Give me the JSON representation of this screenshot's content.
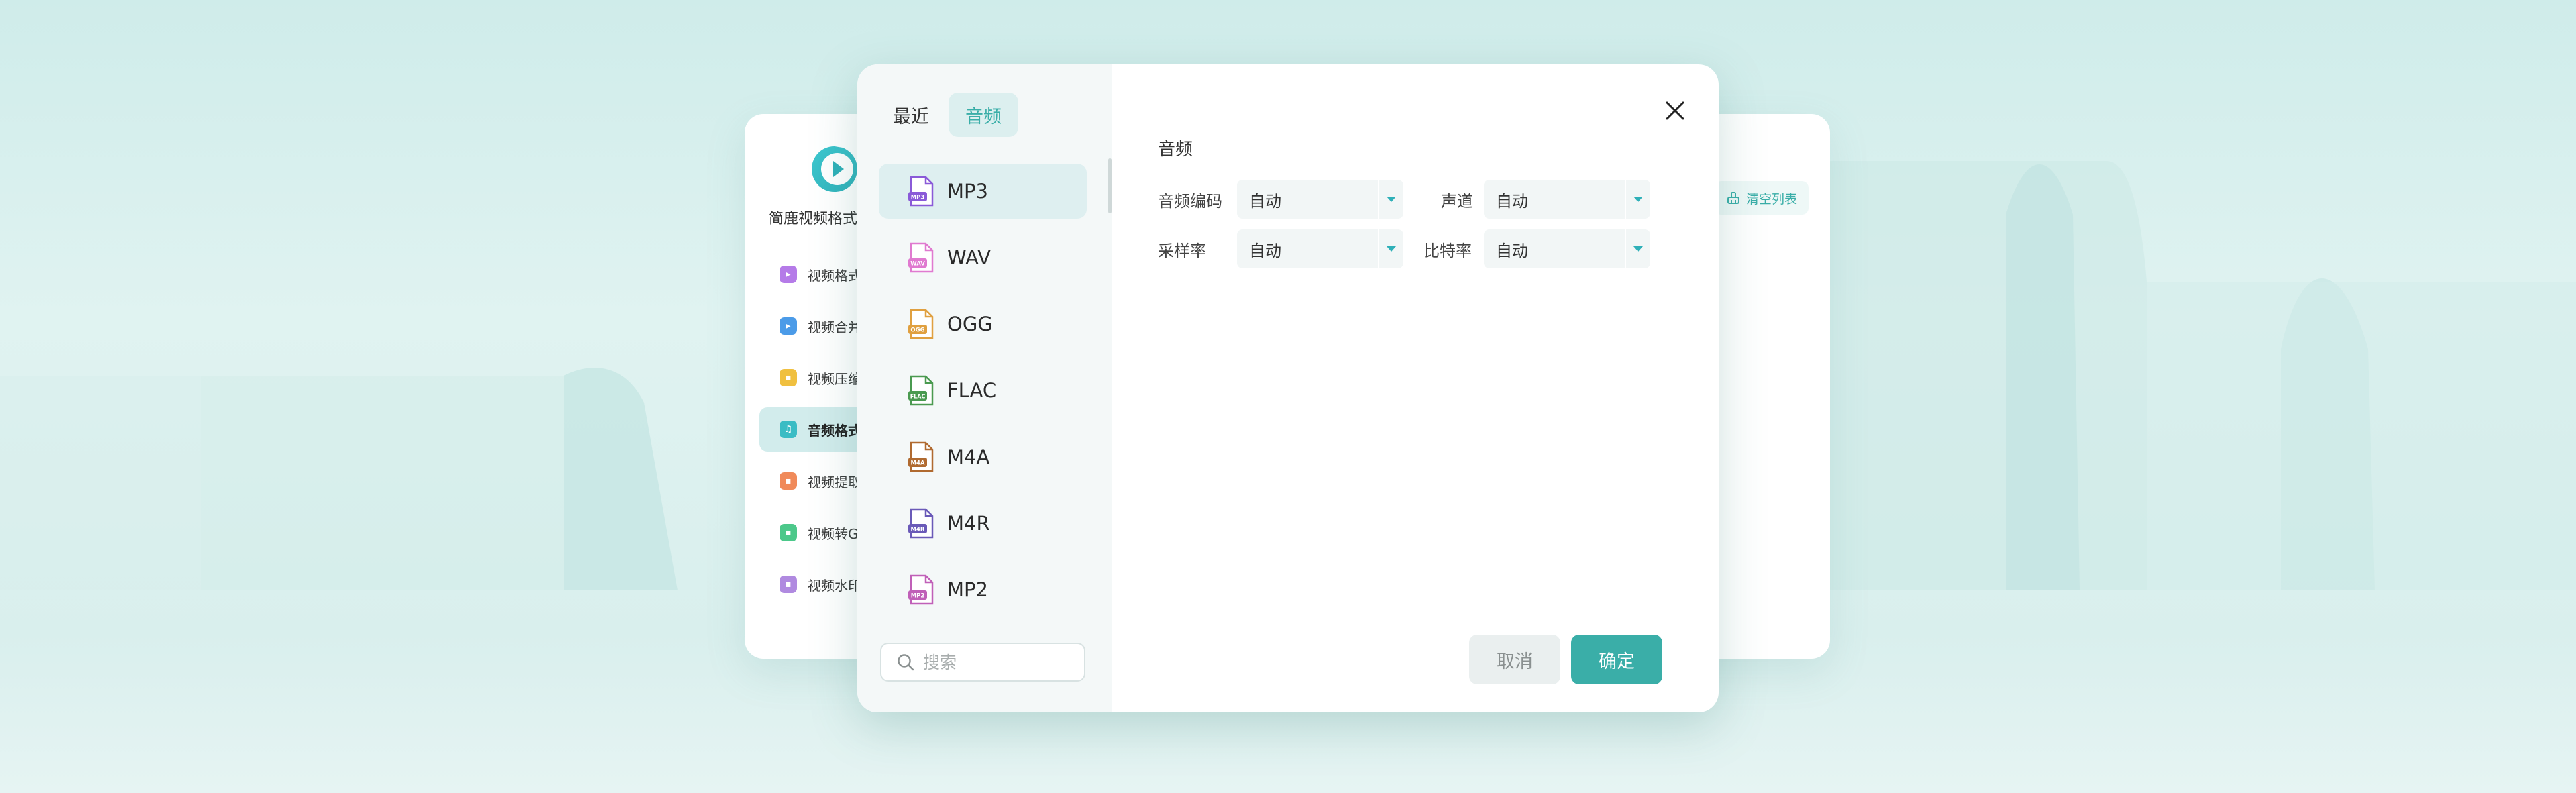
{
  "app": {
    "name": "简鹿视频格式",
    "clear_list_label": "清空列表",
    "nav": [
      {
        "label": "视频格式",
        "icon": "video-convert-icon",
        "color": "#b57be8"
      },
      {
        "label": "视频合并",
        "icon": "video-merge-icon",
        "color": "#4b9be8"
      },
      {
        "label": "视频压缩",
        "icon": "video-compress-icon",
        "color": "#f0c040"
      },
      {
        "label": "音频格式",
        "icon": "audio-convert-icon",
        "color": "#3abcc4"
      },
      {
        "label": "视频提取",
        "icon": "video-extract-icon",
        "color": "#f08a5a"
      },
      {
        "label": "视频转GIF",
        "icon": "video-gif-icon",
        "color": "#4cc88a"
      },
      {
        "label": "视频水印",
        "icon": "video-watermark-icon",
        "color": "#b08ae0"
      }
    ]
  },
  "dialog": {
    "tabs": {
      "recent": "最近",
      "audio": "音频"
    },
    "formats": [
      {
        "label": "MP3",
        "badge": "MP3",
        "color": "#8a5ad8"
      },
      {
        "label": "WAV",
        "badge": "WAV",
        "color": "#e07ad0"
      },
      {
        "label": "OGG",
        "badge": "OGG",
        "color": "#e0a040"
      },
      {
        "label": "FLAC",
        "badge": "FLAC",
        "color": "#4a9a50"
      },
      {
        "label": "M4A",
        "badge": "M4A",
        "color": "#b06a30"
      },
      {
        "label": "M4R",
        "badge": "M4R",
        "color": "#6a5ab8"
      },
      {
        "label": "MP2",
        "badge": "MP2",
        "color": "#c060b8"
      }
    ],
    "search_placeholder": "搜索",
    "section_title": "音频",
    "fields": {
      "audio_codec": {
        "label": "音频编码",
        "value": "自动"
      },
      "channel": {
        "label": "声道",
        "value": "自动"
      },
      "sample_rate": {
        "label": "采样率",
        "value": "自动"
      },
      "bitrate": {
        "label": "比特率",
        "value": "自动"
      }
    },
    "cancel_label": "取消",
    "confirm_label": "确定"
  },
  "colors": {
    "accent": "#3aaea8",
    "arrow": "#2fb0b8"
  }
}
